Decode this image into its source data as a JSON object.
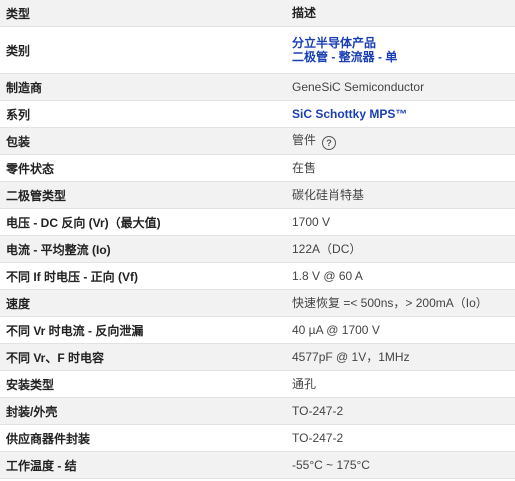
{
  "header": {
    "type_label": "类型",
    "desc_label": "描述"
  },
  "rows": [
    {
      "label": "类别",
      "values": [
        "分立半导体产品",
        "二极管 - 整流器 - 单"
      ]
    },
    {
      "label": "制造商",
      "value": "GeneSiC Semiconductor"
    },
    {
      "label": "系列",
      "value": "SiC Schottky MPS™"
    },
    {
      "label": "包装",
      "value": "管件",
      "icon": "help-circle-icon"
    },
    {
      "label": "零件状态",
      "value": "在售"
    },
    {
      "label": "二极管类型",
      "value": "碳化硅肖特基"
    },
    {
      "label": "电压 - DC 反向 (Vr)（最大值)",
      "value": "1700 V"
    },
    {
      "label": "电流 - 平均整流 (Io)",
      "value": "122A（DC）"
    },
    {
      "label": "不同 If 时电压 - 正向 (Vf)",
      "value": "1.8 V @ 60 A"
    },
    {
      "label": "速度",
      "value": "快速恢复 =< 500ns，> 200mA（Io）"
    },
    {
      "label": "不同 Vr 时电流 - 反向泄漏",
      "value": "40 µA @ 1700 V"
    },
    {
      "label": "不同 Vr、F 时电容",
      "value": "4577pF @ 1V，1MHz"
    },
    {
      "label": "安装类型",
      "value": "通孔"
    },
    {
      "label": "封装/外壳",
      "value": "TO-247-2"
    },
    {
      "label": "供应商器件封装",
      "value": "TO-247-2"
    },
    {
      "label": "工作温度 - 结",
      "value": "-55°C ~ 175°C"
    }
  ],
  "colors": {
    "link": "#1a3fb5",
    "shade": "#f2f2f2",
    "border": "#e2e2e2"
  }
}
